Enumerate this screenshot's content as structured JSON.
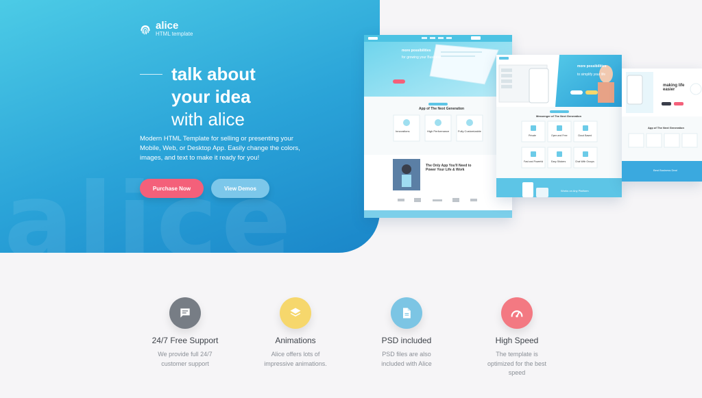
{
  "logo": {
    "name": "alice",
    "subtitle": "HTML template",
    "icon": "fingerprint-icon"
  },
  "hero": {
    "title_line1": "talk about",
    "title_line2": "your idea",
    "title_line3": "with alice",
    "description": "Modern HTML Template for selling or presenting your Mobile, Web, or Desktop App. Easily change the colors, images, and text to make it ready for you!",
    "watermark": "alice",
    "purchase_label": "Purchase Now",
    "demos_label": "View Demos"
  },
  "mockups": {
    "m1": {
      "hero_title": "more possibilities",
      "hero_sub": "for growing your Business",
      "section_title": "App of The Next Generation",
      "cards": [
        "Innovations",
        "High Performance",
        "Fully Customizable"
      ],
      "feature_title": "The Only App You'll Need to Power Your Life & Work"
    },
    "m2": {
      "hero_title": "more possibilities",
      "hero_sub": "to simplify your life",
      "section_title": "Messenger of The Next Generation",
      "cards": [
        "Private",
        "Open and Free",
        "Cloud Based",
        "Fast and Powerful",
        "Easy Stickers",
        "Chat With Groups"
      ],
      "footer_title": "Works on Any Platform"
    },
    "m3": {
      "hero_title": "making life easier",
      "section_title": "App of The Next Generation",
      "footer_title": "Best Business Deal"
    }
  },
  "features": [
    {
      "icon": "chat-icon",
      "color": "#777d85",
      "title": "24/7 Free Support",
      "desc1": "We provide full 24/7",
      "desc2": "customer support",
      "desc3": ""
    },
    {
      "icon": "layers-icon",
      "color": "#f6d76c",
      "title": "Animations",
      "desc1": "Alice offers lots of",
      "desc2": "impressive animations.",
      "desc3": ""
    },
    {
      "icon": "file-icon",
      "color": "#7cc5e4",
      "title": "PSD included",
      "desc1": "PSD files are also",
      "desc2": "included with Alice",
      "desc3": ""
    },
    {
      "icon": "speedometer-icon",
      "color": "#f37982",
      "title": "High Speed",
      "desc1": "The template is",
      "desc2": "optimized for the best",
      "desc3": "speed"
    }
  ],
  "colors": {
    "accent": "#f4607a",
    "hero_start": "#4ccbe6",
    "hero_end": "#1a86c9"
  }
}
